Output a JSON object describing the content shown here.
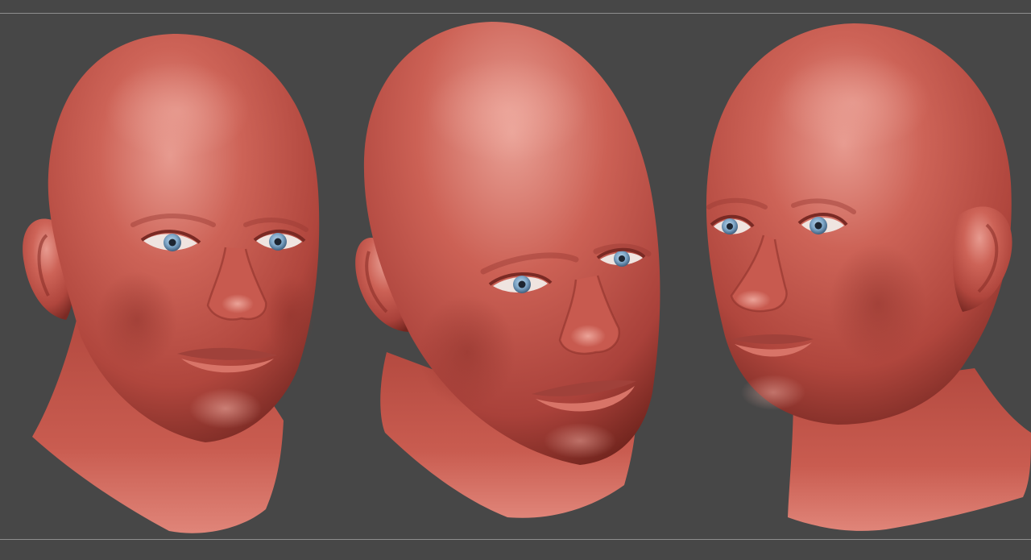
{
  "canvas": {
    "background_color": "#474747",
    "guide_line_color": "#8e8e8e",
    "material_base_color": "#c8574d",
    "material_highlight_color": "#e79a8f",
    "material_shadow_color": "#7a2a24",
    "eye_iris_color": "#7fa7c8"
  },
  "views": [
    {
      "id": "front-three-quarter-view",
      "angle": "front"
    },
    {
      "id": "tilted-three-quarter-view",
      "angle": "tilted"
    },
    {
      "id": "side-three-quarter-view",
      "angle": "side"
    }
  ]
}
